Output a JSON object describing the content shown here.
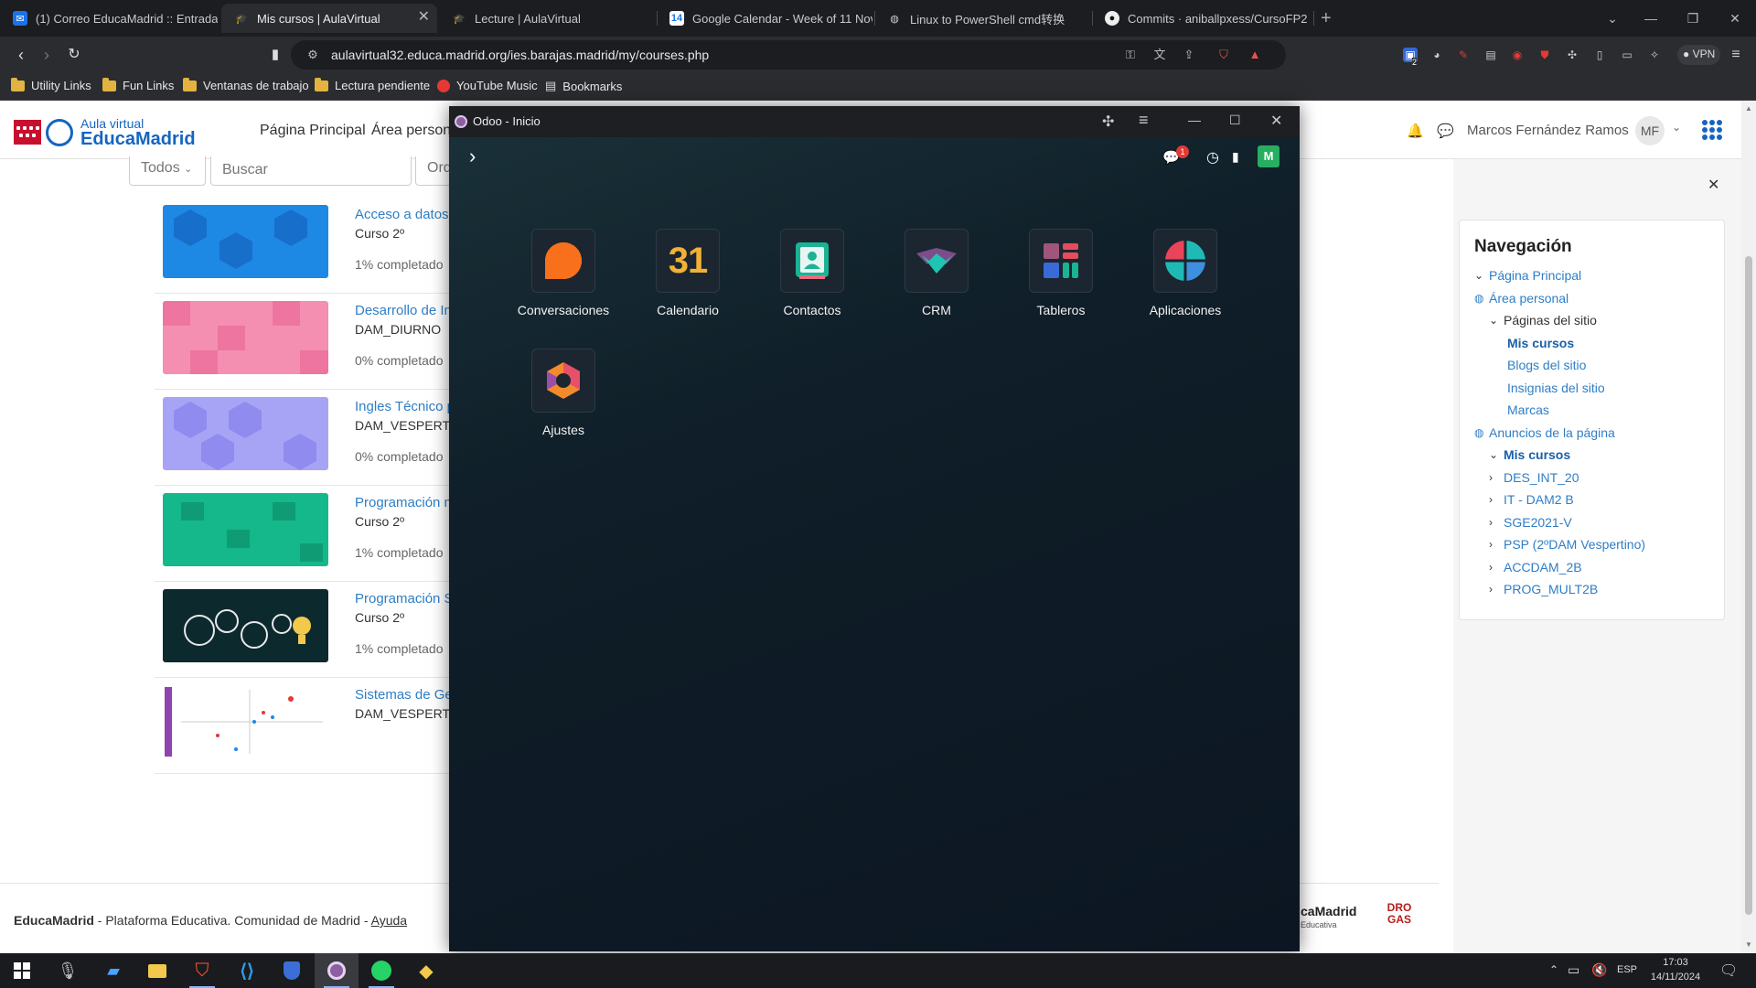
{
  "browser": {
    "tabs": [
      {
        "label": "(1) Correo EducaMadrid :: Entrada",
        "icon": "mail-icon"
      },
      {
        "label": "Mis cursos | AulaVirtual",
        "icon": "aulavirtual-icon",
        "active": true
      },
      {
        "label": "Lecture | AulaVirtual",
        "icon": "aulavirtual-icon"
      },
      {
        "label": "Google Calendar - Week of 11 Nov",
        "icon": "calendar-icon"
      },
      {
        "label": "Linux to PowerShell cmd转换",
        "icon": "globe-icon"
      },
      {
        "label": "Commits · aniballpxess/CursoFP2",
        "icon": "github-icon"
      }
    ],
    "tab_close": "✕",
    "new_tab": "+",
    "url": "aulavirtual32.educa.madrid.org/ies.barajas.madrid/my/courses.php",
    "vpn_label": "VPN",
    "ext_badge": "2",
    "bookmarks": [
      {
        "label": "Utility Links",
        "icon": "folder-icon"
      },
      {
        "label": "Fun Links",
        "icon": "folder-icon"
      },
      {
        "label": "Ventanas de trabajo",
        "icon": "folder-icon"
      },
      {
        "label": "Lectura pendiente",
        "icon": "folder-icon"
      },
      {
        "label": "YouTube Music",
        "icon": "youtube-music-icon"
      },
      {
        "label": "Bookmarks",
        "icon": "bookmarks-icon"
      }
    ]
  },
  "site": {
    "logo_small": "Aula virtual",
    "logo_big": "EducaMadrid",
    "nav": [
      "Página Principal",
      "Área personal"
    ],
    "user_name": "Marcos Fernández Ramos",
    "user_initials": "MF",
    "filter_all": "Todos",
    "search_placeholder": "Buscar",
    "sort_partial": "Ord",
    "courses": [
      {
        "title": "Acceso a datos",
        "sub": "Curso 2º",
        "progress": "1% completado",
        "colors": [
          "#1e88e5",
          "#1565c0"
        ]
      },
      {
        "title": "Desarrollo de In",
        "sub": "DAM_DIURNO",
        "progress": "0% completado",
        "colors": [
          "#f48fb1",
          "#ec6f9b"
        ]
      },
      {
        "title": "Ingles Técnico p",
        "sub": "DAM_VESPERTI",
        "progress": "0% completado",
        "colors": [
          "#a8a4f5",
          "#8f8bef"
        ]
      },
      {
        "title": "Programación m",
        "sub": "Curso 2º",
        "progress": "1% completado",
        "colors": [
          "#14b88a",
          "#0f9c74"
        ]
      },
      {
        "title": "Programación S",
        "sub": "Curso 2º",
        "progress": "1% completado",
        "colors": [
          "#0c2a2e",
          "#0a1f22"
        ]
      },
      {
        "title": "Sistemas de Ge",
        "sub": "DAM_VESPERTI",
        "progress": "",
        "colors": [
          "#ffffff",
          "#f3f3f3"
        ]
      }
    ],
    "footer": {
      "brand": "EducaMadrid",
      "text": " - Plataforma Educativa. Comunidad de Madrid - ",
      "link": "Ayuda",
      "logo_right_big": "caMadrid",
      "logo_right_small": "Educativa",
      "stamp": "DRO GAS"
    }
  },
  "drawer": {
    "title": "Navegación",
    "close": "✕",
    "items": [
      {
        "label": "Página Principal",
        "level": 0,
        "chev": "⌄",
        "bold": false
      },
      {
        "label": "Área personal",
        "level": 0,
        "chev": "icon",
        "bold": false
      },
      {
        "label": "Páginas del sitio",
        "level": 1,
        "chev": "⌄",
        "bold": false,
        "dark": true
      },
      {
        "label": "Mis cursos",
        "level": 2,
        "chev": "",
        "bold": true
      },
      {
        "label": "Blogs del sitio",
        "level": 2,
        "chev": "",
        "bold": false
      },
      {
        "label": "Insignias del sitio",
        "level": 2,
        "chev": "",
        "bold": false
      },
      {
        "label": "Marcas",
        "level": 2,
        "chev": "",
        "bold": false
      },
      {
        "label": "Anuncios de la página",
        "level": 0,
        "chev": "icon",
        "bold": false
      },
      {
        "label": "Mis cursos",
        "level": 1,
        "chev": "⌄",
        "bold": true
      },
      {
        "label": "DES_INT_20",
        "level": 1,
        "chev": "›",
        "bold": false
      },
      {
        "label": "IT - DAM2 B",
        "level": 1,
        "chev": "›",
        "bold": false
      },
      {
        "label": "SGE2021-V",
        "level": 1,
        "chev": "›",
        "bold": false
      },
      {
        "label": "PSP (2ºDAM Vespertino)",
        "level": 1,
        "chev": "›",
        "bold": false
      },
      {
        "label": "ACCDAM_2B",
        "level": 1,
        "chev": "›",
        "bold": false
      },
      {
        "label": "PROG_MULT2B",
        "level": 1,
        "chev": "›",
        "bold": false
      }
    ]
  },
  "odoo": {
    "window_title": "Odoo - Inicio",
    "chat_badge": "1",
    "avatar_letter": "M",
    "apps": [
      {
        "label": "Conversaciones",
        "icon": "conversations-icon"
      },
      {
        "label": "Calendario",
        "icon": "calendar-31-icon",
        "glyph": "31"
      },
      {
        "label": "Contactos",
        "icon": "contacts-icon"
      },
      {
        "label": "CRM",
        "icon": "crm-handshake-icon"
      },
      {
        "label": "Tableros",
        "icon": "dashboards-icon"
      },
      {
        "label": "Aplicaciones",
        "icon": "apps-icon"
      },
      {
        "label": "Ajustes",
        "icon": "settings-icon"
      }
    ]
  },
  "taskbar": {
    "lang": "ESP",
    "time": "17:03",
    "date": "14/11/2024"
  }
}
